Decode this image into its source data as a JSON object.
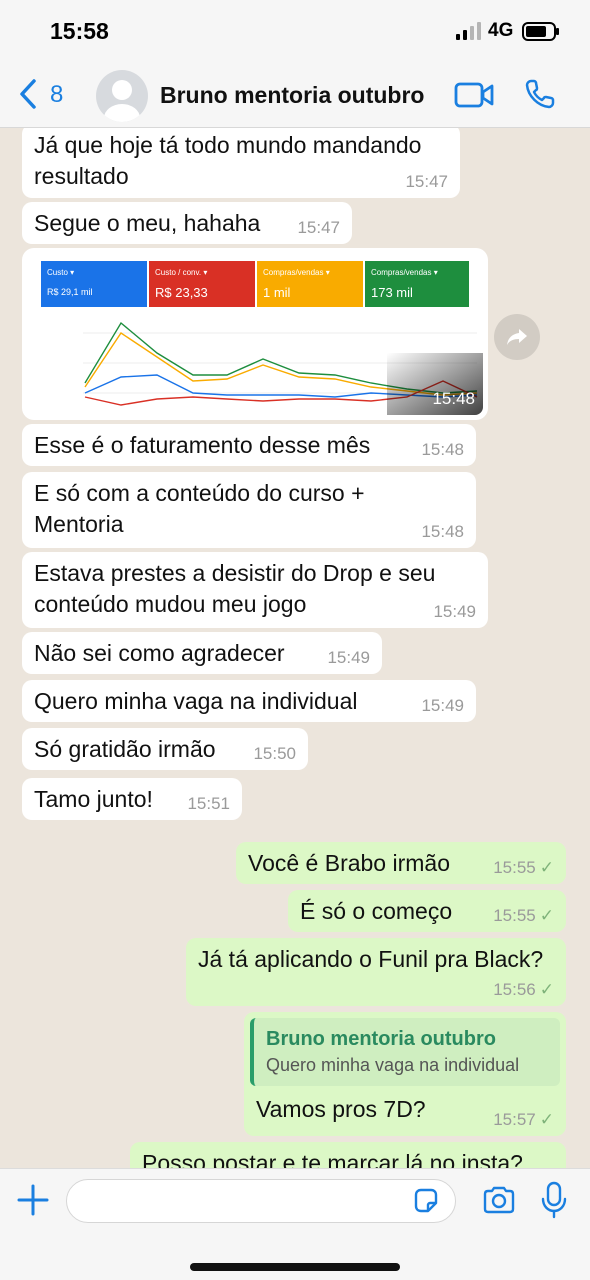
{
  "status": {
    "time": "15:58",
    "network": "4G"
  },
  "header": {
    "back_count": "8",
    "contact_name": "Bruno mentoria outubro"
  },
  "image_message": {
    "time": "15:48",
    "metrics": [
      {
        "label": "Custo",
        "value": "R$ 29,1 mil",
        "color": "#1a73e8"
      },
      {
        "label": "Custo / conv.",
        "value": "R$ 23,33",
        "color": "#d93025"
      },
      {
        "label": "Compras/vendas",
        "value": "1 mil",
        "color": "#f9ab00"
      },
      {
        "label": "Compras/vendas",
        "value": "173 mil",
        "color": "#1e8e3e"
      }
    ]
  },
  "messages": [
    {
      "direction": "in",
      "text": "Já que hoje tá todo mundo mandando resultado",
      "time": "15:47"
    },
    {
      "direction": "in",
      "text": "Segue o meu, hahaha",
      "time": "15:47"
    },
    {
      "direction": "in",
      "text": "Esse é o faturamento desse mês",
      "time": "15:48"
    },
    {
      "direction": "in",
      "text": "E só com a conteúdo do curso + Mentoria",
      "time": "15:48"
    },
    {
      "direction": "in",
      "text": "Estava prestes a desistir do Drop e seu conteúdo mudou meu jogo",
      "time": "15:49"
    },
    {
      "direction": "in",
      "text": "Não sei como agradecer",
      "time": "15:49"
    },
    {
      "direction": "in",
      "text": "Quero minha vaga na individual",
      "time": "15:49"
    },
    {
      "direction": "in",
      "text": "Só gratidão irmão",
      "time": "15:50"
    },
    {
      "direction": "in",
      "text": "Tamo junto!",
      "time": "15:51"
    },
    {
      "direction": "out",
      "text": "Você é Brabo irmão",
      "time": "15:55"
    },
    {
      "direction": "out",
      "text": "É só o começo",
      "time": "15:55"
    },
    {
      "direction": "out",
      "text": "Já tá aplicando o Funil pra Black?",
      "time": "15:56"
    },
    {
      "direction": "out",
      "text": "Vamos pros 7D?",
      "time": "15:57",
      "quote_name": "Bruno mentoria outubro",
      "quote_text": "Quero minha vaga na individual"
    },
    {
      "direction": "out",
      "text": "Posso postar e te marcar lá no insta?",
      "time": ""
    }
  ]
}
